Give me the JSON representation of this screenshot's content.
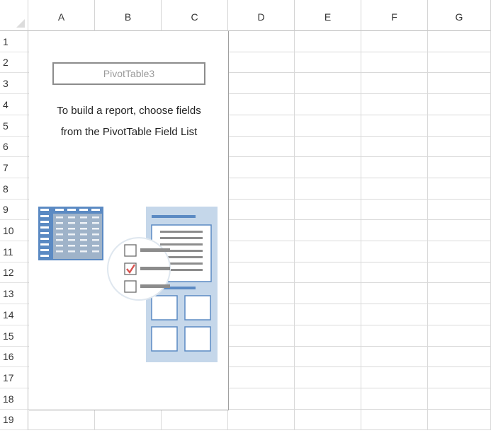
{
  "columns": [
    "A",
    "B",
    "C",
    "D",
    "E",
    "F",
    "G"
  ],
  "rows": [
    "1",
    "2",
    "3",
    "4",
    "5",
    "6",
    "7",
    "8",
    "9",
    "10",
    "11",
    "12",
    "13",
    "14",
    "15",
    "16",
    "17",
    "18",
    "19"
  ],
  "pivot": {
    "name": "PivotTable3",
    "instruction_line1": "To build a report, choose fields",
    "instruction_line2": "from the PivotTable Field List"
  },
  "colors": {
    "blue_dark": "#5b8ac3",
    "blue_light": "#c5d7ea",
    "check_red": "#d9534f",
    "gray_mid": "#8c8c8c"
  }
}
